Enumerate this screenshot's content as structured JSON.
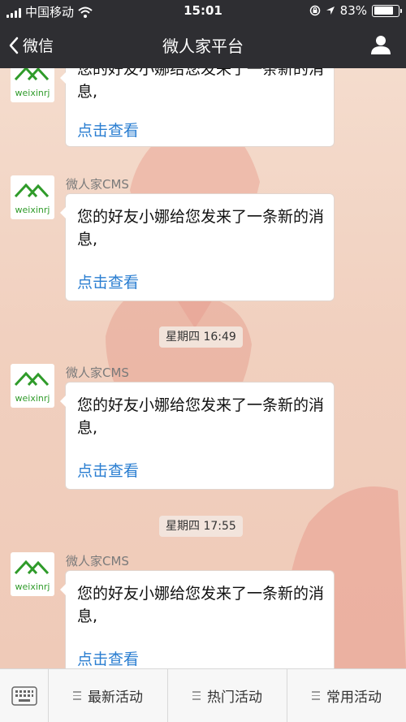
{
  "status_bar": {
    "carrier": "中国移动",
    "time": "15:01",
    "battery_text": "83%",
    "battery_level": 0.83,
    "icons": [
      "signal-icon",
      "wifi-icon",
      "rotation-lock-icon",
      "location-icon",
      "battery-icon"
    ]
  },
  "nav": {
    "back_label": "微信",
    "title": "微人家平台",
    "icons": [
      "chevron-left-icon",
      "user-icon"
    ]
  },
  "avatar": {
    "text": "weixinrj",
    "icon": "house-logo-icon",
    "brand_color": "#2f9b2a"
  },
  "messages": [
    {
      "sender": "",
      "text": "您的好友小娜给您发来了一条新的消息,",
      "link": "点击查看"
    },
    {
      "sender": "微人家CMS",
      "text": "您的好友小娜给您发来了一条新的消息,",
      "link": "点击查看"
    },
    {
      "sender": "微人家CMS",
      "text": "您的好友小娜给您发来了一条新的消息,",
      "link": "点击查看"
    },
    {
      "sender": "微人家CMS",
      "text": "您的好友小娜给您发来了一条新的消息,",
      "link": "点击查看"
    }
  ],
  "timestamps": [
    "星期四 16:49",
    "星期四 17:55"
  ],
  "bottom_menu": {
    "keyboard_icon": "keyboard-icon",
    "items": [
      {
        "label": "最新活动",
        "icon": "menu-lines-icon"
      },
      {
        "label": "热门活动",
        "icon": "menu-lines-icon"
      },
      {
        "label": "常用活动",
        "icon": "menu-lines-icon"
      }
    ]
  },
  "colors": {
    "bar_bg": "#2e2e32",
    "link": "#2a7ed1",
    "chat_bg": "#f1d0bf"
  }
}
